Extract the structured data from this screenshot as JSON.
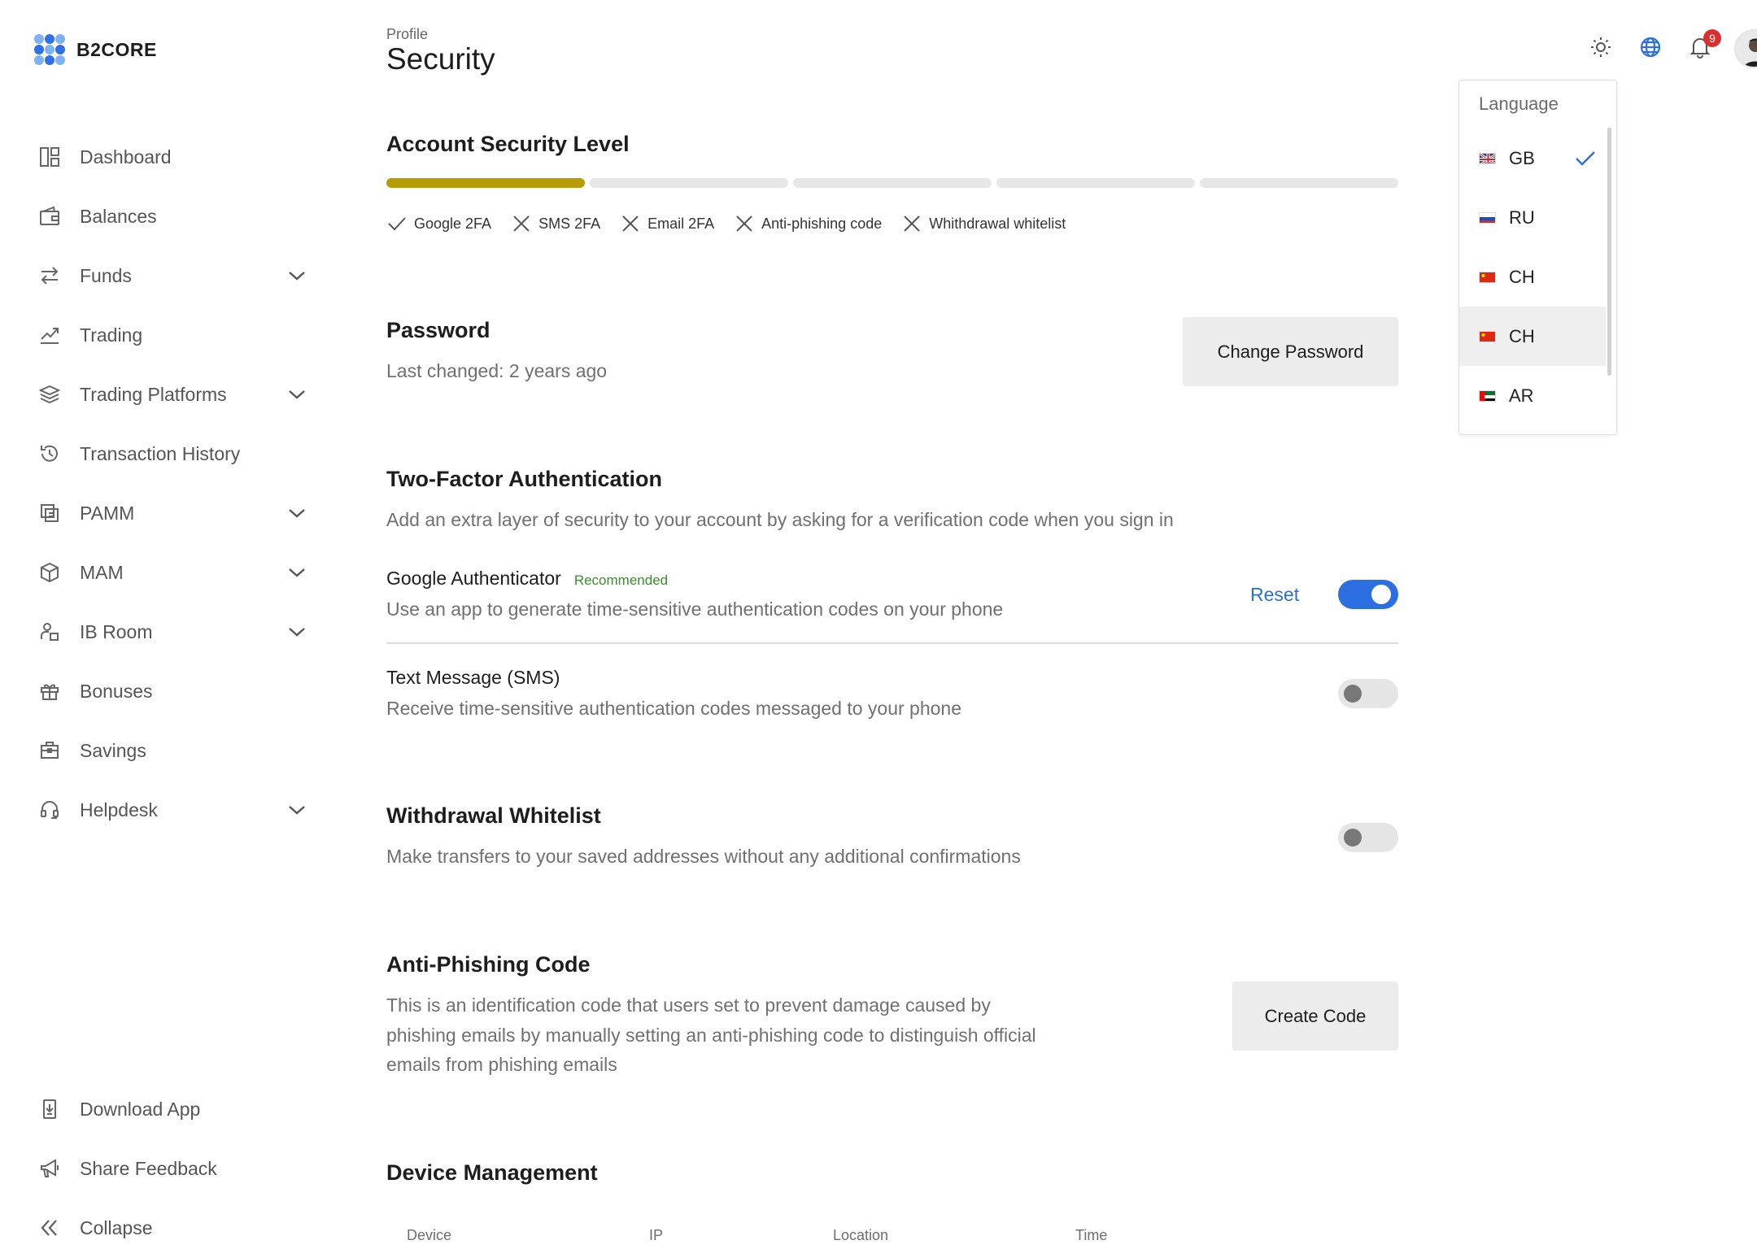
{
  "brand": {
    "name": "B2CORE"
  },
  "sidebar": {
    "items": [
      {
        "label": "Dashboard",
        "icon": "dashboard-icon"
      },
      {
        "label": "Balances",
        "icon": "wallet-icon"
      },
      {
        "label": "Funds",
        "icon": "arrows-swap-icon"
      },
      {
        "label": "Trading",
        "icon": "chart-line-icon"
      },
      {
        "label": "Trading Platforms",
        "icon": "layers-icon"
      },
      {
        "label": "Transaction History",
        "icon": "history-icon"
      },
      {
        "label": "PAMM",
        "icon": "copy-icon"
      },
      {
        "label": "MAM",
        "icon": "cube-icon"
      },
      {
        "label": "IB Room",
        "icon": "users-icon"
      },
      {
        "label": "Bonuses",
        "icon": "gift-icon"
      },
      {
        "label": "Savings",
        "icon": "briefcase-icon"
      },
      {
        "label": "Helpdesk",
        "icon": "headset-icon"
      }
    ],
    "bottom": [
      {
        "label": "Download App",
        "icon": "download-icon"
      },
      {
        "label": "Share Feedback",
        "icon": "megaphone-icon"
      },
      {
        "label": "Collapse",
        "icon": "double-chevron-left-icon"
      }
    ]
  },
  "header": {
    "breadcrumb": "Profile",
    "title": "Security",
    "notifications_count": "9"
  },
  "language_menu": {
    "title": "Language",
    "items": [
      {
        "code": "GB",
        "selected": true
      },
      {
        "code": "RU"
      },
      {
        "code": "CH"
      },
      {
        "code": "CH"
      },
      {
        "code": "AR"
      }
    ]
  },
  "security_level": {
    "title": "Account Security Level",
    "level": "1 of 5",
    "bar_color": "#b79c08",
    "checks": [
      {
        "label": "Google 2FA",
        "done": true
      },
      {
        "label": "SMS 2FA",
        "done": false
      },
      {
        "label": "Email 2FA",
        "done": false
      },
      {
        "label": "Anti-phishing code",
        "done": false
      },
      {
        "label": "Whithdrawal whitelist",
        "done": false
      }
    ]
  },
  "password": {
    "title": "Password",
    "subtitle": "Last changed: 2 years ago",
    "button": "Change Password"
  },
  "two_factor": {
    "title": "Two-Factor Authentication",
    "subtitle": "Add an extra layer of security to your account by asking for a verification code when you sign in",
    "google": {
      "title": "Google Authenticator",
      "badge": "Recommended",
      "subtitle": "Use an app to generate time-sensitive authentication codes on your phone",
      "reset": "Reset",
      "enabled": true
    },
    "sms": {
      "title": "Text Message (SMS)",
      "subtitle": "Receive time-sensitive authentication codes messaged to your phone",
      "enabled": false
    }
  },
  "whitelist": {
    "title": "Withdrawal Whitelist",
    "subtitle": "Make transfers to your saved addresses without any additional confirmations",
    "enabled": false
  },
  "anti_phishing": {
    "title": "Anti-Phishing Code",
    "lines": [
      "This is an identification code that users set to prevent damage caused by",
      "phishing emails by manually setting an anti-phishing code to distinguish official",
      "emails from phishing emails"
    ],
    "button": "Create Code"
  },
  "devices": {
    "title": "Device Management",
    "columns": [
      "Device",
      "IP",
      "Location",
      "Time"
    ]
  },
  "colors": {
    "accent": "#2b6fe0",
    "recommended": "#3a8c2c",
    "badge": "#d93131"
  }
}
